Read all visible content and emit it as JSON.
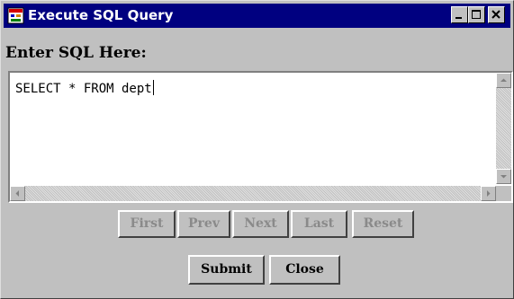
{
  "window": {
    "title": "Execute SQL Query",
    "minimize_icon": "minimize-icon",
    "maximize_icon": "maximize-icon",
    "close_icon": "close-icon"
  },
  "label": "Enter SQL Here:",
  "editor": {
    "value": "SELECT * FROM dept"
  },
  "nav_buttons": {
    "first": "First",
    "prev": "Prev",
    "next": "Next",
    "last": "Last",
    "reset": "Reset"
  },
  "actions": {
    "submit": "Submit",
    "close": "Close"
  },
  "colors": {
    "titlebar": "#000080",
    "face": "#c0c0c0",
    "disabled_text": "#8a8a8a"
  }
}
